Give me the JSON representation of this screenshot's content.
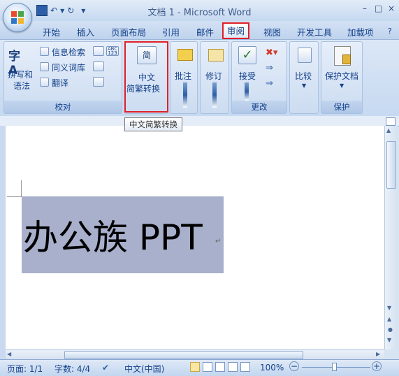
{
  "window": {
    "title": "文档 1 - Microsoft Word",
    "controls": [
      "–",
      "□",
      "×"
    ]
  },
  "quick_access": {
    "save_icon": "save-icon",
    "undo_icon": "undo-icon",
    "redo_icon": "redo-icon"
  },
  "tabs": [
    {
      "label": "开始"
    },
    {
      "label": "插入"
    },
    {
      "label": "页面布局"
    },
    {
      "label": "引用"
    },
    {
      "label": "邮件"
    },
    {
      "label": "审阅",
      "active": true
    },
    {
      "label": "视图"
    },
    {
      "label": "开发工具"
    },
    {
      "label": "加载项"
    }
  ],
  "ribbon": {
    "proofing": {
      "label": "校对",
      "spelling_line1": "拼写和",
      "spelling_line2": "语法",
      "research": "信息检索",
      "thesaurus": "同义词库",
      "translate": "翻译"
    },
    "chinese": {
      "convert_line1": "中文",
      "convert_line2": "简繁转换",
      "icon_char": "简"
    },
    "comments": {
      "label": "批注"
    },
    "tracking": {
      "label": "修订"
    },
    "changes": {
      "label": "更改",
      "accept": "接受"
    },
    "compare": {
      "label": "比较"
    },
    "protect": {
      "label": "保护",
      "protect_doc": "保护文档"
    }
  },
  "tooltip": "中文简繁转换",
  "document": {
    "text": "办公族 PPT",
    "paragraph_mark": "↵"
  },
  "statusbar": {
    "page": "页面: 1/1",
    "words": "字数: 4/4",
    "language": "中文(中国)",
    "zoom": "100%",
    "zoom_out": "−",
    "zoom_in": "+"
  },
  "colors": {
    "accent": "#15428b",
    "highlight": "#a8b0cc",
    "red_box": "#e0202a"
  }
}
